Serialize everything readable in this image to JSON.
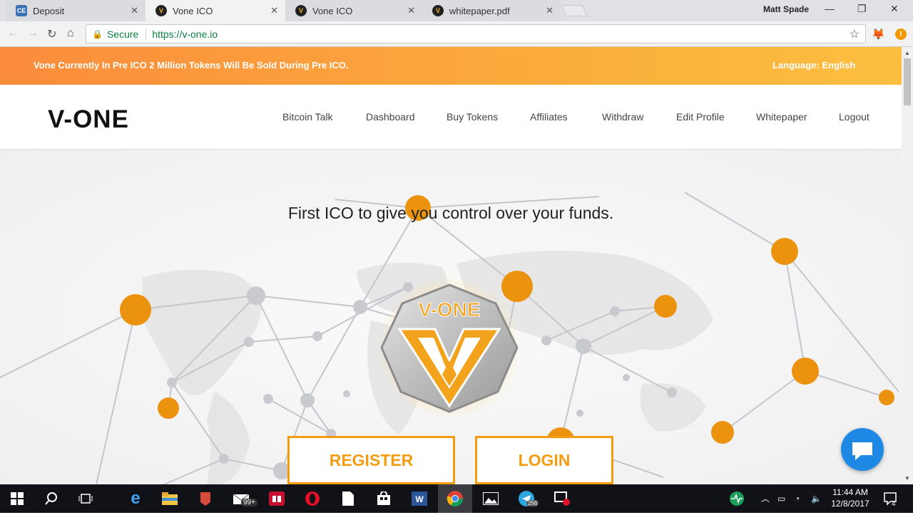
{
  "browser": {
    "tabs": [
      {
        "title": "Deposit",
        "favicon": "CE"
      },
      {
        "title": "Vone ICO",
        "favicon": "V"
      },
      {
        "title": "Vone ICO",
        "favicon": "V"
      },
      {
        "title": "whitepaper.pdf",
        "favicon": "V"
      }
    ],
    "user": "Matt Spade",
    "secure_label": "Secure",
    "url": "https://v-one.io"
  },
  "page": {
    "banner_message": "Vone Currently In Pre ICO 2 Million Tokens Will Be Sold During Pre ICO.",
    "language": "Language: English",
    "logo": "V-ONE",
    "nav": [
      "Bitcoin Talk",
      "Dashboard",
      "Buy Tokens",
      "Affiliates",
      "Withdraw",
      "Edit Profile",
      "Whitepaper",
      "Logout"
    ],
    "tagline": "First ICO to give you control over your funds.",
    "emblem_text": "V-ONE",
    "register_label": "REGISTER",
    "login_label": "LOGIN"
  },
  "taskbar": {
    "mail_badge": "99+",
    "telegram_badge": "256",
    "time": "11:44 AM",
    "date": "12/8/2017",
    "notifications": "4"
  },
  "colors": {
    "accent": "#f39c12",
    "banner_start": "#fb8c3c",
    "banner_end": "#fbbf40",
    "chat": "#1e88e5",
    "secure": "#0b8043"
  }
}
